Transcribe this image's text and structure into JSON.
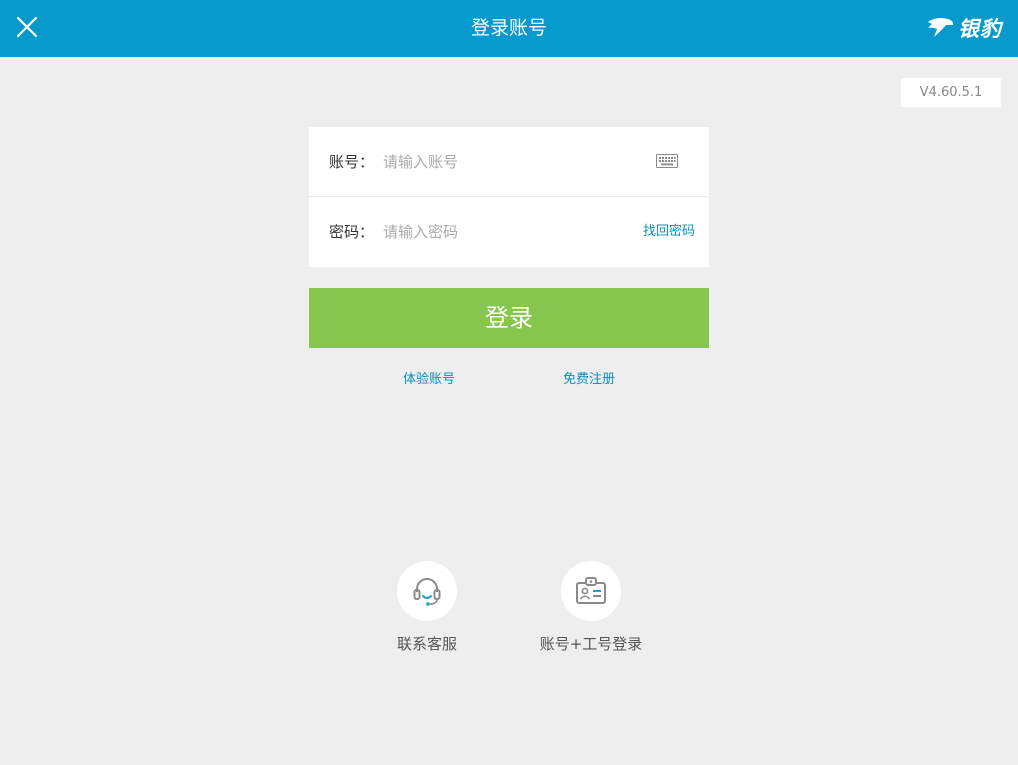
{
  "header": {
    "title": "登录账号",
    "brand": "银豹",
    "background_color": "#0699cc"
  },
  "version": "V4.60.5.1",
  "form": {
    "account": {
      "label": "账号：",
      "placeholder": "请输入账号",
      "value": "",
      "icon": "keyboard-icon"
    },
    "password": {
      "label": "密码：",
      "placeholder": "请输入密码",
      "value": "",
      "forgot_label": "找回密码"
    }
  },
  "login_button": {
    "label": "登录",
    "color": "#86c64d"
  },
  "links": {
    "trial": "体验账号",
    "register": "免费注册",
    "color": "#0a8fbf"
  },
  "bottom_actions": {
    "support": {
      "label": "联系客服",
      "icon": "headset-icon"
    },
    "staff_login": {
      "label": "账号+工号登录",
      "icon": "id-badge-icon"
    }
  }
}
